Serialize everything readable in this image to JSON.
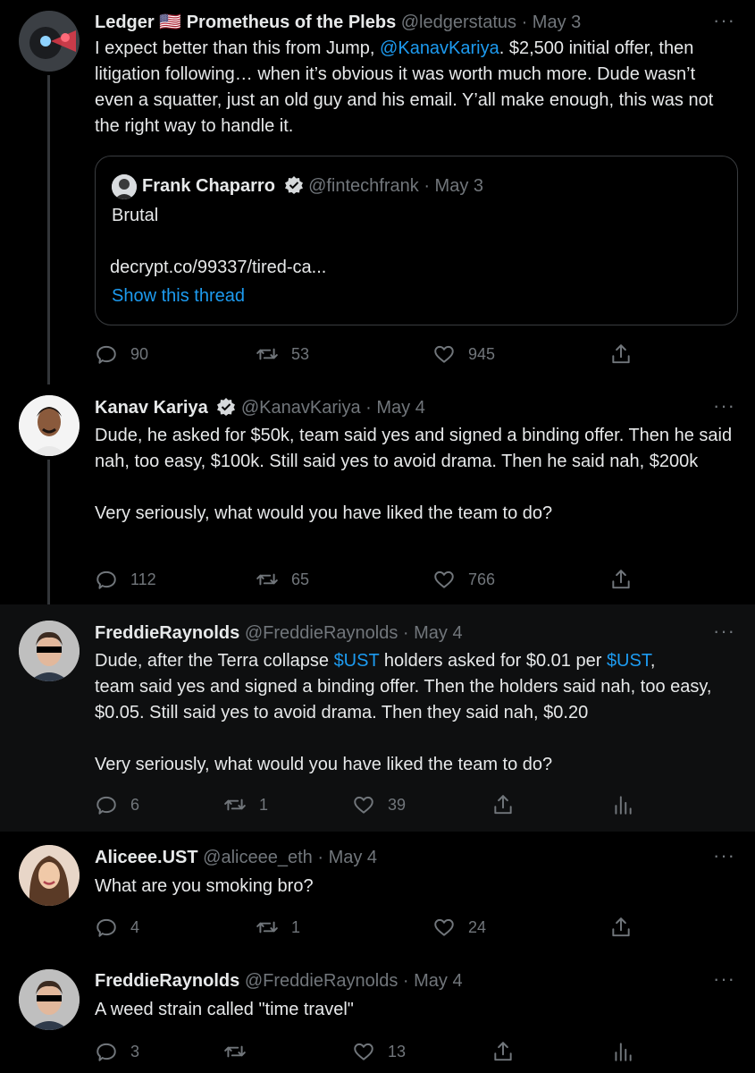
{
  "tweets": [
    {
      "name": "Ledger 🇺🇸 Prometheus of the Plebs",
      "handle": "@ledgerstatus",
      "date": "May 3",
      "text_parts": [
        "I expect better than this from Jump, ",
        "@KanavKariya",
        ". $2,500 initial offer, then litigation following… when it’s obvious it was worth much more. Dude wasn’t even a squatter, just an old guy and his email. Y’all make enough, this was not the right way to handle it."
      ],
      "quote": {
        "name": "Frank Chaparro",
        "handle": "@fintechfrank",
        "date": "May 3",
        "text": "Brutal",
        "link": "decrypt.co/99337/tired-ca...",
        "show_thread": "Show this thread"
      },
      "replies": "90",
      "retweets": "53",
      "likes": "945"
    },
    {
      "name": "Kanav Kariya",
      "handle": "@KanavKariya",
      "date": "May 4",
      "text": "Dude, he asked for $50k, team said yes and signed a binding offer. Then he said nah, too easy, $100k. Still said yes to avoid drama. Then he said nah, $200k\n\nVery seriously, what would you have liked the team to do?",
      "replies": "112",
      "retweets": "65",
      "likes": "766"
    },
    {
      "name": "FreddieRaynolds",
      "handle": "@FreddieRaynolds",
      "date": "May 4",
      "text_parts": [
        "Dude, after the Terra collapse ",
        "$UST",
        " holders asked for $0.01 per ",
        "$UST",
        ",\nteam said yes and signed a binding offer. Then the holders said nah, too easy, $0.05. Still said yes to avoid drama. Then they said nah, $0.20\n\nVery seriously, what would you have liked the team to do?"
      ],
      "replies": "6",
      "retweets": "1",
      "likes": "39"
    },
    {
      "name": "Aliceee.UST",
      "handle": "@aliceee_eth",
      "date": "May 4",
      "text": "What are you smoking bro?",
      "replies": "4",
      "retweets": "1",
      "likes": "24"
    },
    {
      "name": "FreddieRaynolds",
      "handle": "@FreddieRaynolds",
      "date": "May 4",
      "text": "A weed strain called \"time travel\"",
      "replies": "3",
      "retweets": "",
      "likes": "13"
    }
  ],
  "colors": {
    "accent": "#1d9bf0",
    "secondary": "#71767b",
    "background": "#000000"
  }
}
